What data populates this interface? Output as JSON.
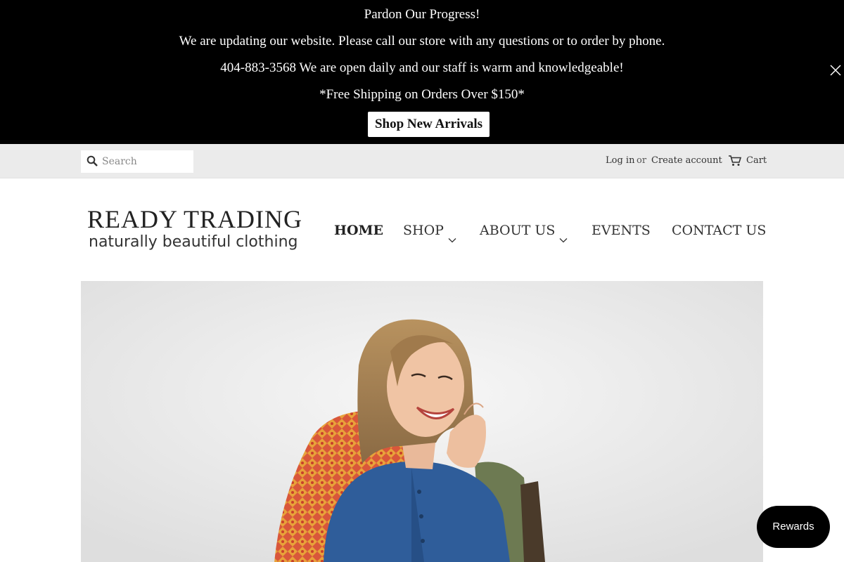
{
  "announcement": {
    "line1": "Pardon Our Progress!",
    "line2": "We are updating our website. Please call our store with any questions or to order by phone.",
    "line3": "404-883-3568 We are open daily and our staff is warm and knowledgeable!",
    "line4": "*Free Shipping on Orders Over $150*",
    "cta_label": "Shop New Arrivals",
    "close_icon": "close-icon",
    "background": "#000000"
  },
  "utility": {
    "search_placeholder": "Search",
    "login_label": "Log in",
    "or_label": "or",
    "create_account_label": "Create account",
    "cart_label": "Cart",
    "background": "#ebebeb"
  },
  "header": {
    "logo_brand": "READY TRADING",
    "logo_tagline": "naturally beautiful clothing",
    "nav": [
      {
        "label": "HOME",
        "active": true
      },
      {
        "label": "SHOP",
        "dropdown": true
      },
      {
        "label": "ABOUT US",
        "dropdown": true
      },
      {
        "label": "EVENTS"
      },
      {
        "label": "CONTACT US"
      }
    ]
  },
  "hero": {
    "image": "woman-in-blue-linen-shirt-laughing-in-patterned-chair"
  },
  "rewards": {
    "label": "Rewards"
  }
}
